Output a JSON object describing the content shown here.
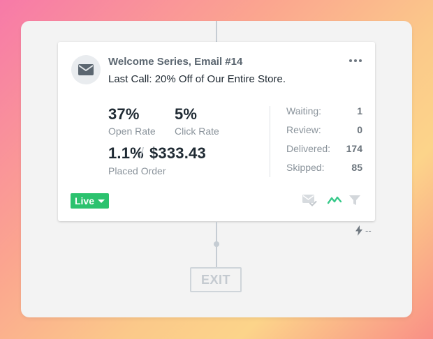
{
  "card": {
    "title": "Welcome Series, Email #14",
    "subject": "Last Call: 20% Off of Our Entire Store.",
    "icon": "envelope-icon",
    "more_icon": "more-horizontal-icon"
  },
  "metrics": {
    "open_rate_value": "37%",
    "open_rate_label": "Open Rate",
    "click_rate_value": "5%",
    "click_rate_label": "Click Rate",
    "placed_order_rate": "1.1%",
    "placed_order_sep": "/",
    "placed_order_revenue": "$333.43",
    "placed_order_label": "Placed Order"
  },
  "stats": [
    {
      "label": "Waiting:",
      "value": "1"
    },
    {
      "label": "Review:",
      "value": "0"
    },
    {
      "label": "Delivered:",
      "value": "174"
    },
    {
      "label": "Skipped:",
      "value": "85"
    }
  ],
  "status": {
    "label": "Live",
    "color": "#2bc26e",
    "icons": [
      "mail-check-icon",
      "trend-line-icon",
      "filter-icon"
    ]
  },
  "trigger": {
    "icon": "lightning-bolt-icon",
    "text": "--"
  },
  "exit": {
    "label": "EXIT"
  }
}
